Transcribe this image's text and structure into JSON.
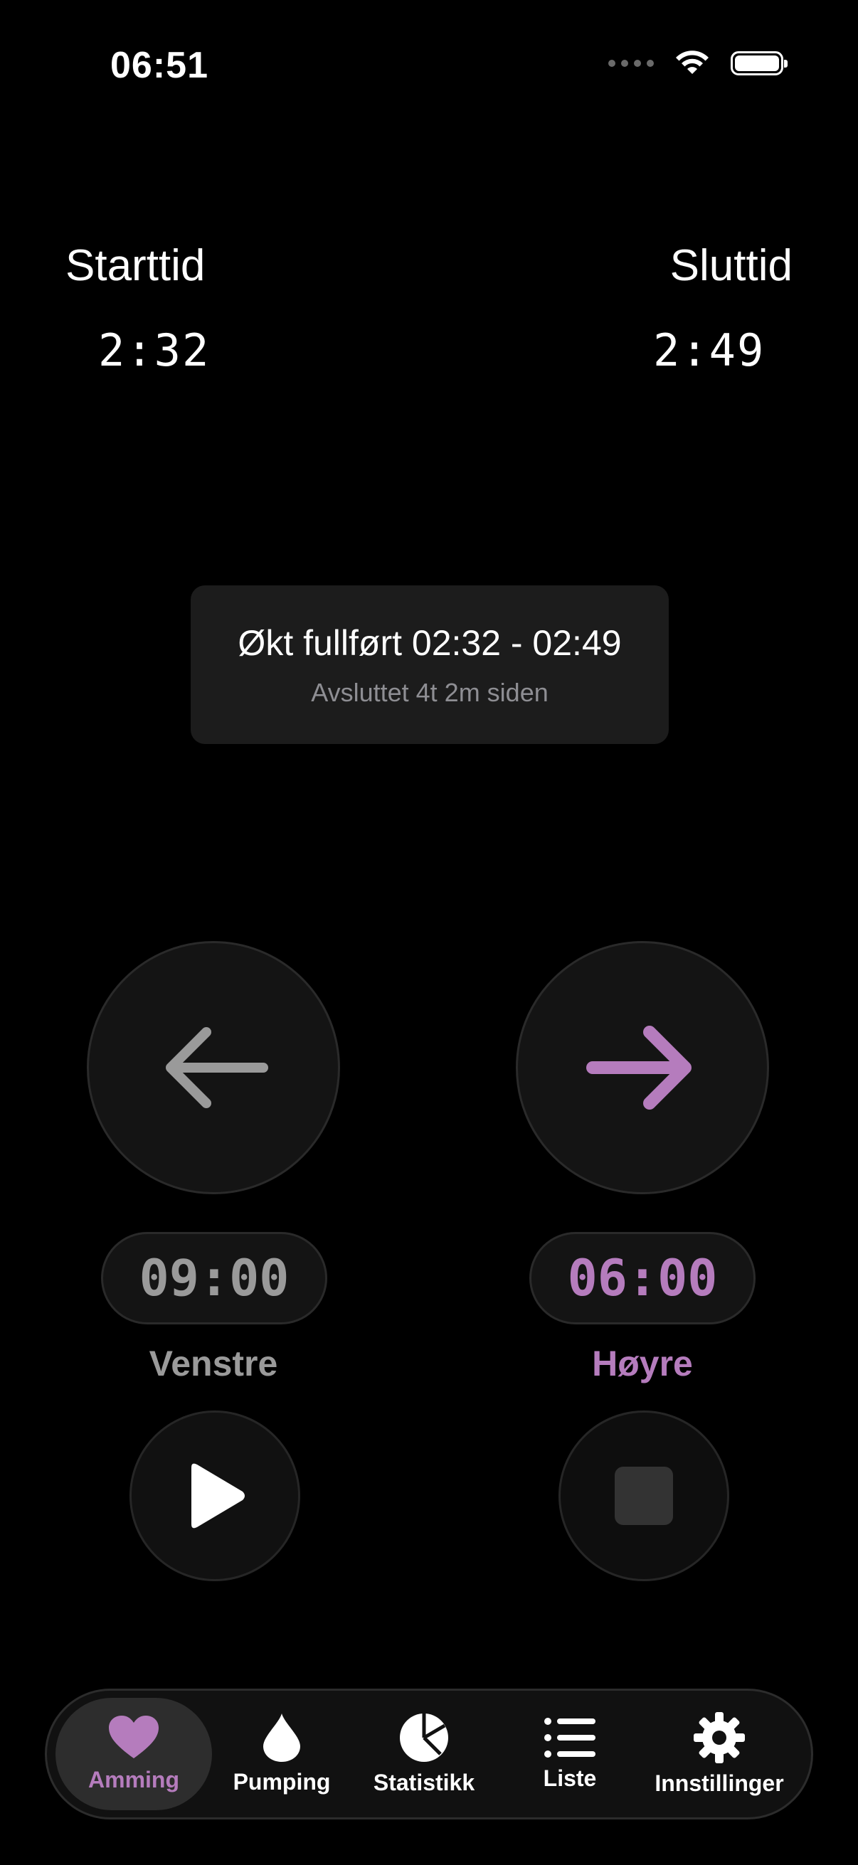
{
  "status_bar": {
    "time": "06:51"
  },
  "times": {
    "start_label": "Starttid",
    "start_value": "2:32",
    "end_label": "Sluttid",
    "end_value": "2:49"
  },
  "session": {
    "title": "Økt fullført 02:32 - 02:49",
    "subtitle": "Avsluttet 4t 2m siden"
  },
  "left": {
    "timer": "09:00",
    "label": "Venstre",
    "icon": "arrow-left-icon",
    "color": "#9a9a9a",
    "control": "play-icon"
  },
  "right": {
    "timer": "06:00",
    "label": "Høyre",
    "icon": "arrow-right-icon",
    "color": "#b57cbd",
    "control": "stop-icon"
  },
  "tabs": [
    {
      "label": "Amming",
      "icon": "heart-icon",
      "active": true
    },
    {
      "label": "Pumping",
      "icon": "drop-icon",
      "active": false
    },
    {
      "label": "Statistikk",
      "icon": "pie-chart-icon",
      "active": false
    },
    {
      "label": "Liste",
      "icon": "list-icon",
      "active": false
    },
    {
      "label": "Innstillinger",
      "icon": "gear-icon",
      "active": false
    }
  ],
  "colors": {
    "accent": "#b57cbd",
    "inactive": "#9a9a9a",
    "background": "#000000"
  }
}
